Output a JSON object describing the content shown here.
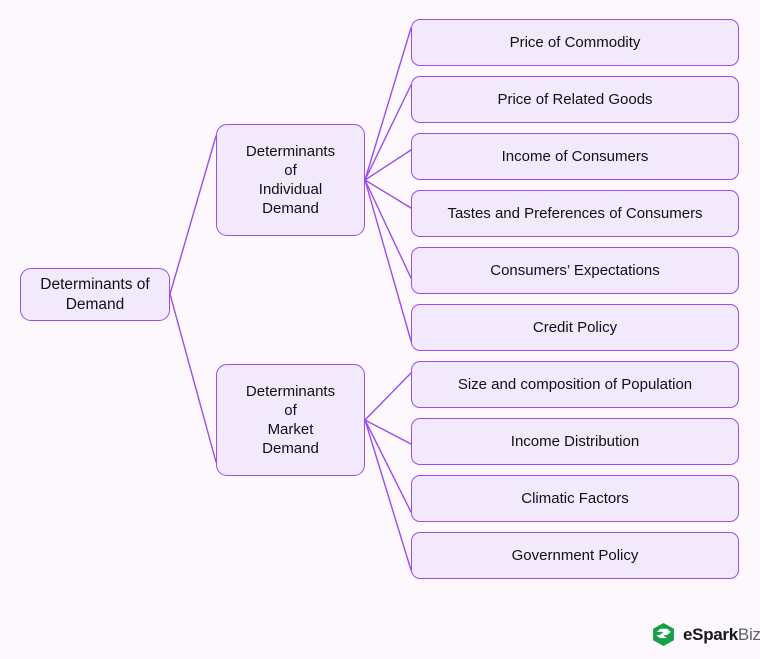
{
  "page": {
    "background_color": "#fcf8fd",
    "title": "Determinants of Demand"
  },
  "theme": {
    "node_fill": "#f2e9fc",
    "node_border": "#9b4dee",
    "edge_color": "#9b4dee",
    "text_color": "#111014",
    "logo_green": "#17a04a"
  },
  "diagram": {
    "type": "mind-map",
    "root": {
      "label_lines": [
        "Determinants of",
        "Demand"
      ]
    },
    "branches": [
      {
        "id": "individual-demand",
        "label_lines": [
          "Determinants",
          "of",
          "Individual",
          "Demand"
        ],
        "leaves": [
          {
            "label": "Price of Commodity"
          },
          {
            "label": "Price of Related Goods"
          },
          {
            "label": "Income of Consumers"
          },
          {
            "label": "Tastes and Preferences of Consumers"
          },
          {
            "label": "Consumers’ Expectations"
          },
          {
            "label": "Credit Policy"
          }
        ]
      },
      {
        "id": "market-demand",
        "label_lines": [
          "Determinants",
          "of",
          "Market",
          "Demand"
        ],
        "leaves": [
          {
            "label": "Size and composition of Population"
          },
          {
            "label": "Income Distribution"
          },
          {
            "label": "Climatic Factors"
          },
          {
            "label": "Government Policy"
          }
        ]
      }
    ]
  },
  "brand": {
    "name_bold": "eSpark",
    "name_light": "Biz",
    "icon": "esparkbiz-hex-logo"
  }
}
